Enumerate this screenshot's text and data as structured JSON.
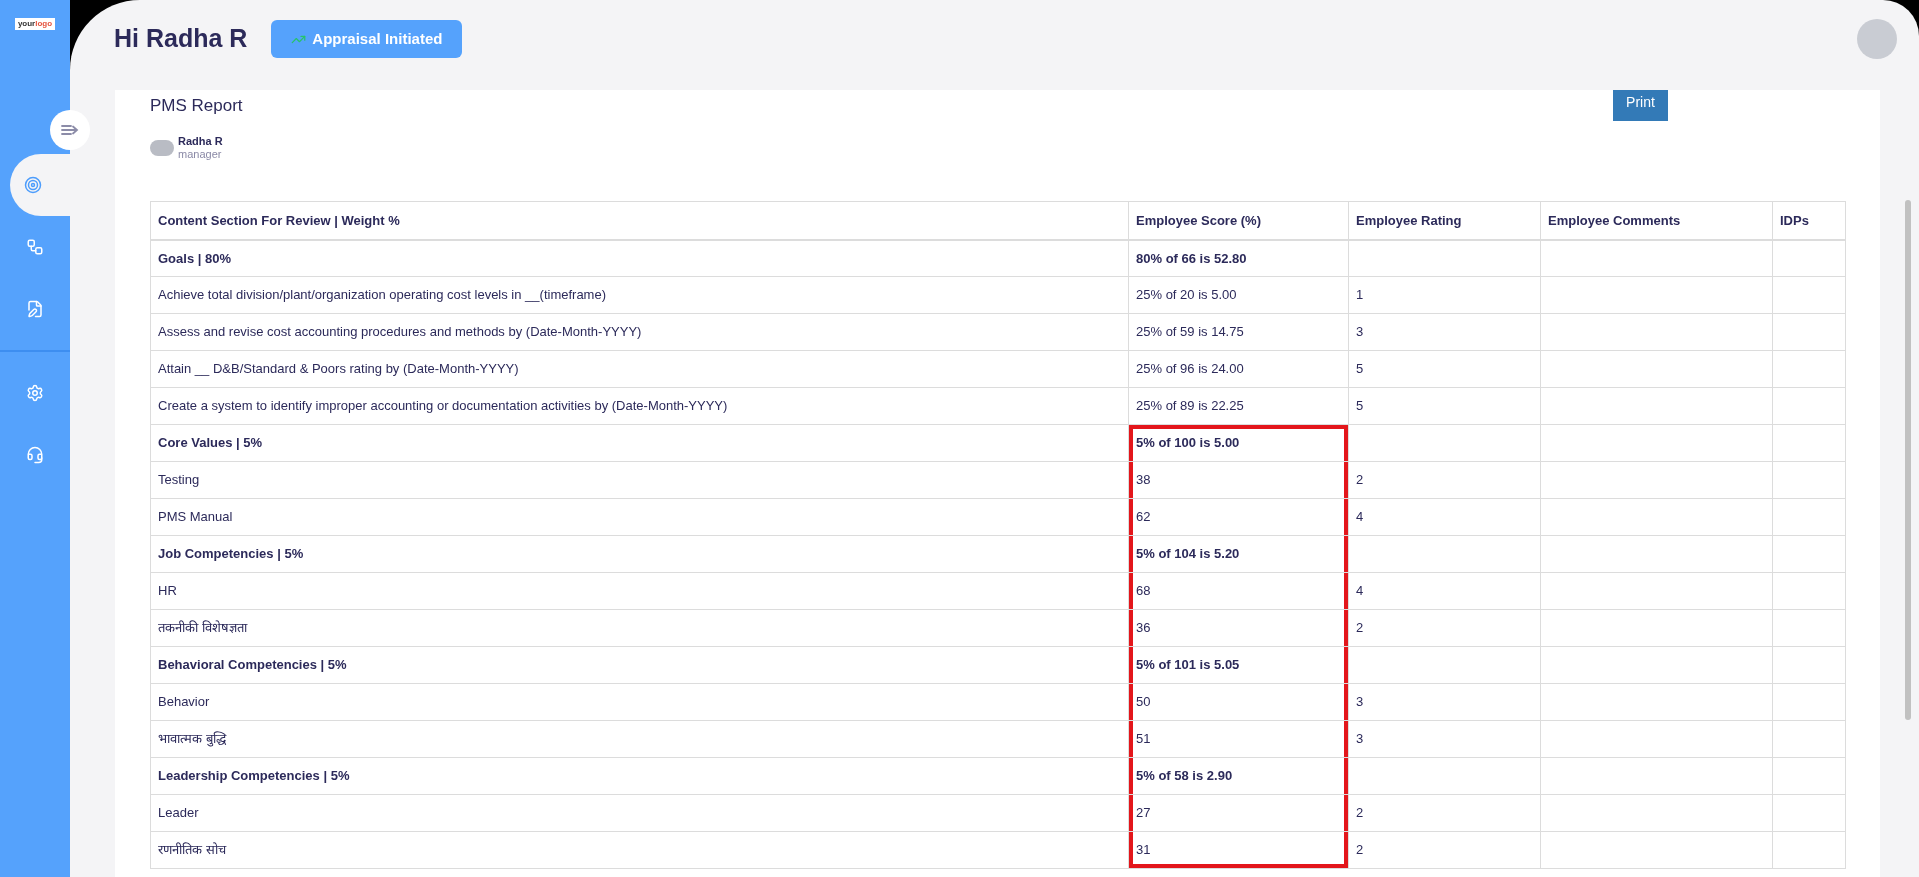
{
  "logo": {
    "text_main": "your",
    "text_accent": "logo"
  },
  "sidebar": {
    "items": [
      {
        "selected": true
      },
      {
        "selected": false
      },
      {
        "selected": false
      },
      {
        "selected": false
      },
      {
        "selected": false
      }
    ]
  },
  "header": {
    "greeting": "Hi Radha R",
    "status_badge": "Appraisal Initiated"
  },
  "report": {
    "title": "PMS Report",
    "print_button": "Print",
    "user": {
      "name": "Radha R",
      "role": "manager"
    }
  },
  "table": {
    "columns": [
      "Content Section For Review | Weight %",
      "Employee Score (%)",
      "Employee Rating",
      "Employee Comments",
      "IDPs"
    ],
    "rows": [
      {
        "kind": "section",
        "label": "Goals | 80%",
        "score": "80% of 66 is 52.80",
        "rating": "",
        "highlighted": false
      },
      {
        "kind": "item",
        "label": "Achieve total division/plant/organization operating cost levels in __(timeframe)",
        "score": "25% of 20 is 5.00",
        "rating": "1",
        "highlighted": false
      },
      {
        "kind": "item",
        "label": "Assess and revise cost accounting procedures and methods by (Date-Month-YYYY)",
        "score": "25% of 59 is 14.75",
        "rating": "3",
        "highlighted": false
      },
      {
        "kind": "item",
        "label": "Attain __ D&B/Standard & Poors rating by (Date-Month-YYYY)",
        "score": "25% of 96 is 24.00",
        "rating": "5",
        "highlighted": false
      },
      {
        "kind": "item",
        "label": "Create a system to identify improper accounting or documentation activities by (Date-Month-YYYY)",
        "score": "25% of 89 is 22.25",
        "rating": "5",
        "highlighted": false
      },
      {
        "kind": "section",
        "label": "Core Values | 5%",
        "score": "5% of 100 is 5.00",
        "rating": "",
        "highlighted": true
      },
      {
        "kind": "item",
        "label": "Testing",
        "score": "38",
        "rating": "2",
        "highlighted": true
      },
      {
        "kind": "item",
        "label": "PMS Manual",
        "score": "62",
        "rating": "4",
        "highlighted": true
      },
      {
        "kind": "section",
        "label": "Job Competencies | 5%",
        "score": "5% of 104 is 5.20",
        "rating": "",
        "highlighted": true
      },
      {
        "kind": "item",
        "label": "HR",
        "score": "68",
        "rating": "4",
        "highlighted": true
      },
      {
        "kind": "item",
        "label": "तकनीकी विशेषज्ञता",
        "score": "36",
        "rating": "2",
        "highlighted": true
      },
      {
        "kind": "section",
        "label": "Behavioral Competencies | 5%",
        "score": "5% of 101 is 5.05",
        "rating": "",
        "highlighted": true
      },
      {
        "kind": "item",
        "label": "Behavior",
        "score": "50",
        "rating": "3",
        "highlighted": true
      },
      {
        "kind": "item",
        "label": "भावात्मक बुद्धि",
        "score": "51",
        "rating": "3",
        "highlighted": true
      },
      {
        "kind": "section",
        "label": "Leadership Competencies | 5%",
        "score": "5% of 58 is 2.90",
        "rating": "",
        "highlighted": true
      },
      {
        "kind": "item",
        "label": "Leader",
        "score": "27",
        "rating": "2",
        "highlighted": true
      },
      {
        "kind": "item",
        "label": "रणनीतिक सोच",
        "score": "31",
        "rating": "2",
        "highlighted": true
      }
    ]
  }
}
